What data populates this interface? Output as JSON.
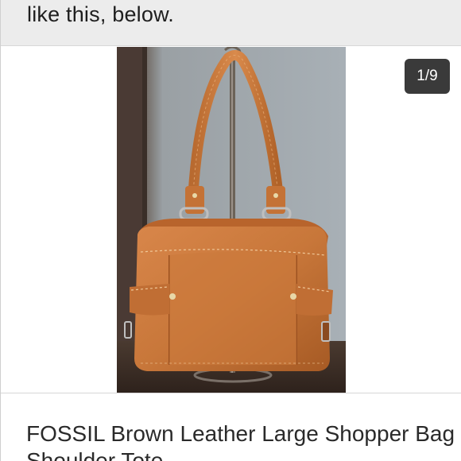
{
  "header": {
    "text": "like this, below."
  },
  "gallery": {
    "counter": "1/9",
    "image_subject": "brown leather tote handbag on a stand"
  },
  "listing": {
    "title": "FOSSIL Brown Leather Large Shopper Bag Shoulder Tote"
  },
  "colors": {
    "header_bg": "#ececec",
    "badge_bg": "#3a3a3a",
    "leather": "#c8773a"
  }
}
